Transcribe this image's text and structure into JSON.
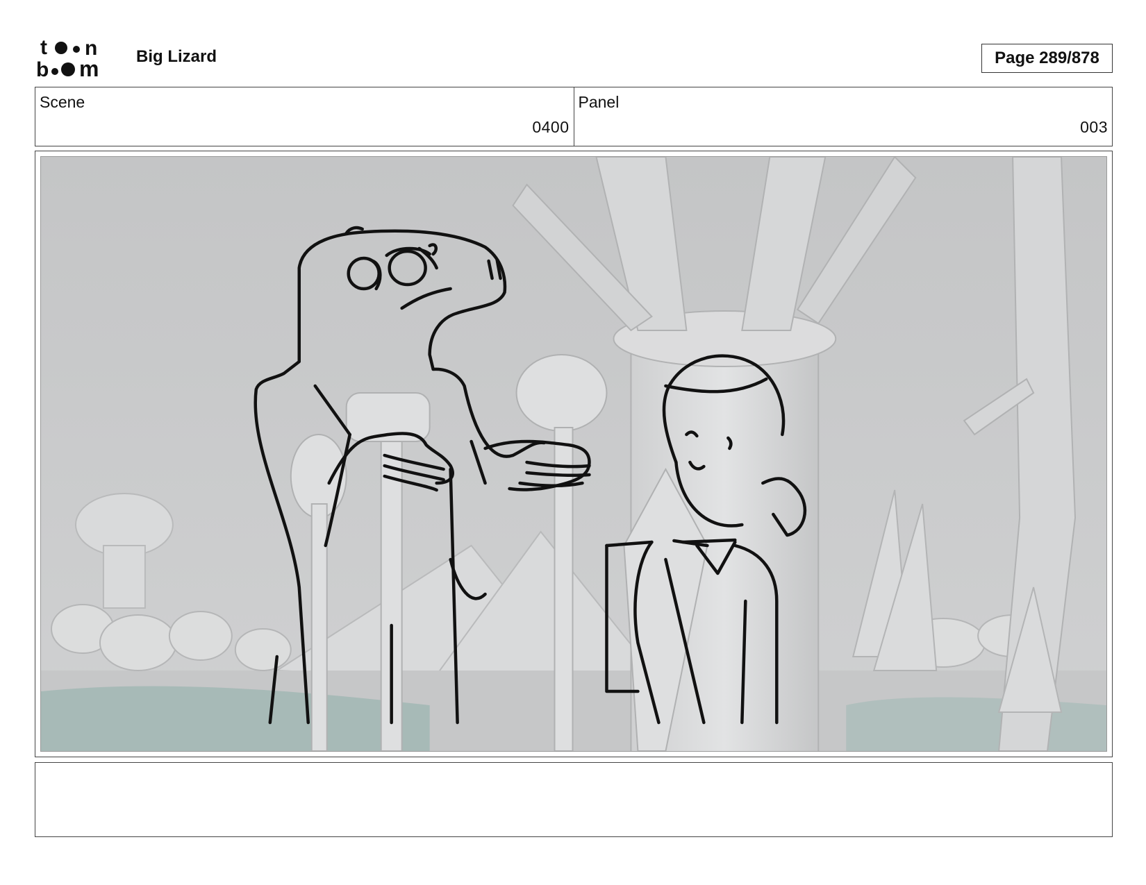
{
  "header": {
    "logo_text": "toon boom",
    "project_title": "Big Lizard",
    "page_label": "Page 289/878"
  },
  "scene": {
    "label": "Scene",
    "value": "0400"
  },
  "panel": {
    "label": "Panel",
    "value": "003"
  },
  "panel_image": {
    "background_color": "#c9cacb",
    "sketch_color": "#111111",
    "water_color": "#9fb7b3"
  },
  "notes": {
    "text": ""
  }
}
